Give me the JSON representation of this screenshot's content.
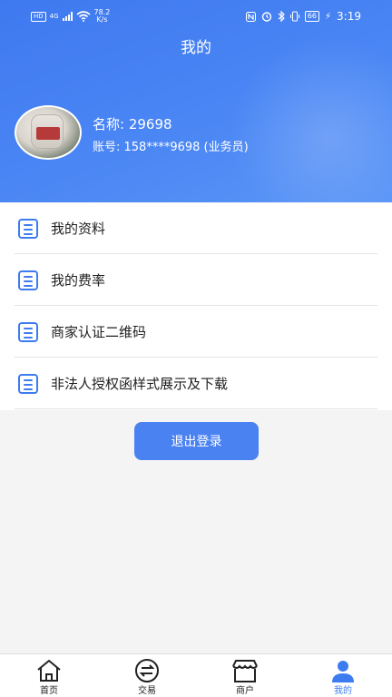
{
  "status_bar": {
    "network_badge": "HD",
    "signal_type": "4G",
    "speed_value": "78.2",
    "speed_unit": "K/s",
    "battery": "66",
    "time": "3:19"
  },
  "header": {
    "title": "我的",
    "user_name": "名称: 29698",
    "account": "账号: 158****9698 (业务员)"
  },
  "menu": {
    "items": [
      {
        "label": "我的资料",
        "icon": "list-icon"
      },
      {
        "label": "我的费率",
        "icon": "list-icon"
      },
      {
        "label": "商家认证二维码",
        "icon": "list-icon"
      },
      {
        "label": "非法人授权函样式展示及下载",
        "icon": "list-icon"
      }
    ]
  },
  "logout_label": "退出登录",
  "tabbar": {
    "tabs": [
      {
        "label": "首页",
        "icon": "home-icon"
      },
      {
        "label": "交易",
        "icon": "exchange-icon"
      },
      {
        "label": "商户",
        "icon": "store-icon"
      },
      {
        "label": "我的",
        "icon": "user-icon"
      }
    ],
    "active_index": 3
  },
  "colors": {
    "accent": "#3d7cf0",
    "header_start": "#3f79f0",
    "button": "#4b82f1"
  }
}
